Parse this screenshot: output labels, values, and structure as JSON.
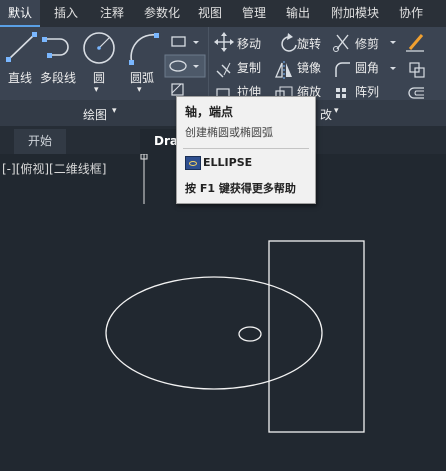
{
  "menu": {
    "tabs": [
      {
        "label": "默认",
        "active": true
      },
      {
        "label": "插入"
      },
      {
        "label": "注释"
      },
      {
        "label": "参数化"
      },
      {
        "label": "视图"
      },
      {
        "label": "管理"
      },
      {
        "label": "输出"
      },
      {
        "label": "附加模块"
      },
      {
        "label": "协作"
      }
    ]
  },
  "draw_panel": {
    "tools": [
      "直线",
      "多段线",
      "圆",
      "圆弧"
    ],
    "title": "绘图",
    "dropdown_glyph": "▾"
  },
  "modify_panel": {
    "tools": [
      "移动",
      "旋转",
      "修剪",
      "复制",
      "镜像",
      "圆角",
      "拉伸",
      "缩放",
      "阵列"
    ],
    "title_tail": "改",
    "dropdown_glyph": "▾"
  },
  "doc_tabs": [
    {
      "label": "开始"
    },
    {
      "label": "Draw",
      "active": true
    }
  ],
  "viewport": {
    "label": "[-][俯视][二维线框]"
  },
  "tooltip": {
    "title": "轴，端点",
    "description": "创建椭圆或椭圆弧",
    "command": "ELLIPSE",
    "help": "按 F1 键获得更多帮助"
  },
  "colors": {
    "ribbon_bg": "#3b4452",
    "canvas_bg": "#212830",
    "accent": "#5aa0e6",
    "geometry_stroke": "#f2f2f2"
  }
}
